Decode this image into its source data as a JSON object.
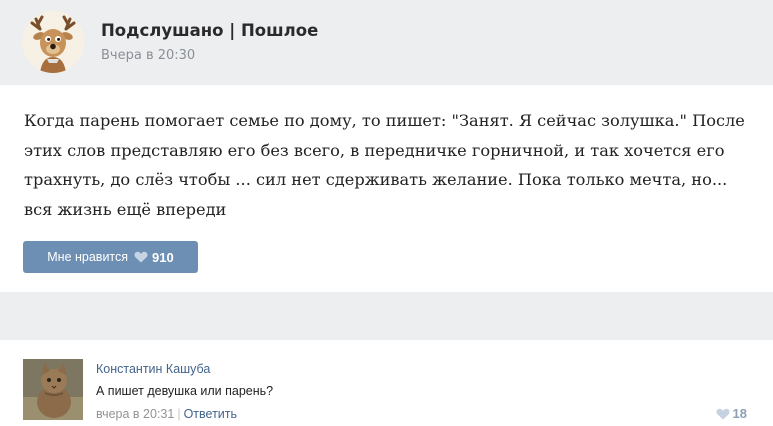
{
  "post": {
    "group_name": "Подслушано | Пошлое",
    "date": "Вчера в 20:30",
    "text": "Когда парень помогает семье по дому, то пишет: \"Занят. Я сейчас золушка.\" После этих слов представляю его без всего, в передничке горничной, и так хочется его трахнуть, до слёз чтобы ... сил нет сдерживать желание. Пока только мечта, но... вся жизнь ещё впереди",
    "like_label": "Мне нравится",
    "like_count": "910"
  },
  "comment": {
    "author": "Константин Кашуба",
    "text": "А пишет девушка или парень?",
    "date": "вчера в 20:31",
    "separator": "|",
    "reply_label": "Ответить",
    "like_count": "18"
  },
  "icons": {
    "group_avatar": "reindeer-avatar-icon",
    "comment_avatar": "cat-avatar-icon",
    "like": "heart-icon"
  },
  "colors": {
    "header_bg": "#edeef0",
    "like_button": "#6e8fb4",
    "link": "#42648b"
  }
}
